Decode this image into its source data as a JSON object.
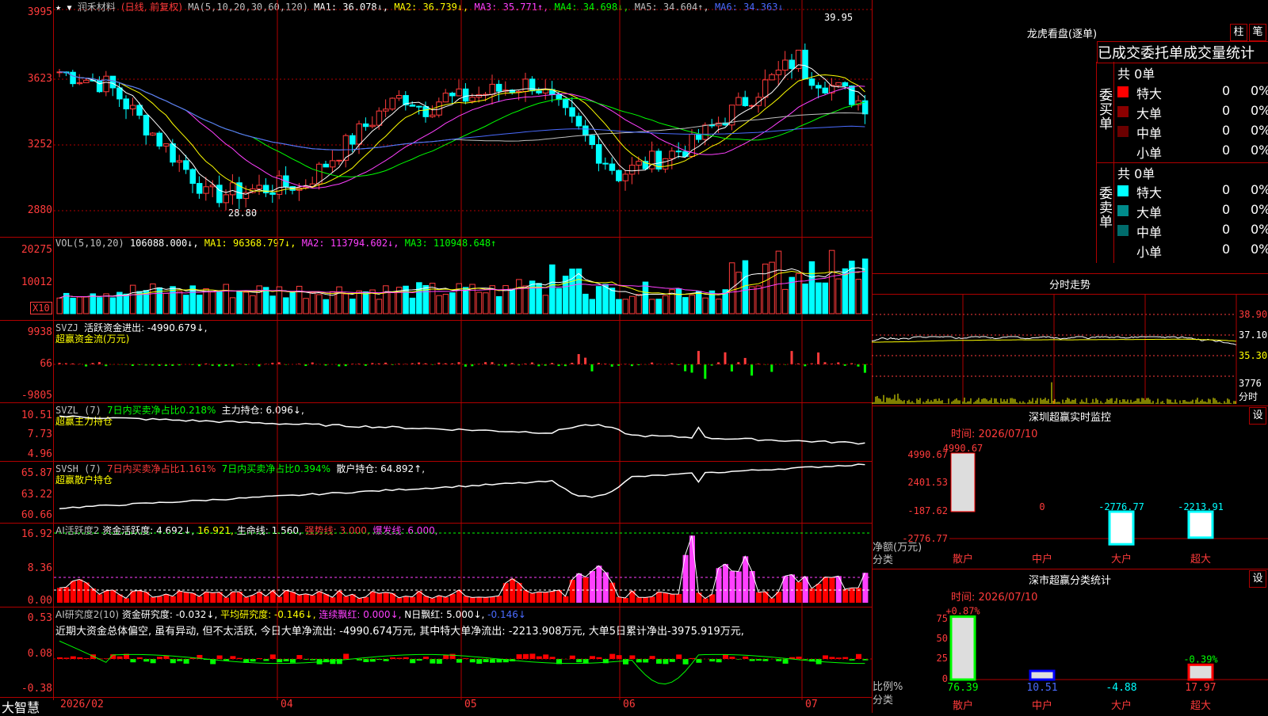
{
  "stock": {
    "name": "润禾材料",
    "mode": "(日线, 前复权)",
    "star": "★",
    "ma_header": {
      "label": "MA(5,10,20,30,60,120)",
      "ma1": "MA1: 36.078↓,",
      "ma2": "MA2: 36.739↓,",
      "ma3": "MA3: 35.771↑,",
      "ma4": "MA4: 34.698↓,",
      "ma5": "MA5: 34.604↑,",
      "ma6": "MA6: 34.363↓"
    },
    "price_axis": [
      "3995",
      "3623",
      "3252",
      "2880"
    ],
    "high_label": "39.95",
    "low_label": "28.80"
  },
  "volume": {
    "header": {
      "label": "VOL(5,10,20)",
      "value": "106088.000↓,",
      "ma1": "MA1: 96368.797↓,",
      "ma2": "MA2: 113794.602↓,",
      "ma3": "MA3: 110948.648↑"
    },
    "axis": [
      "20275",
      "10012"
    ],
    "unit": "X10"
  },
  "svzj": {
    "header": {
      "label": "SVZJ",
      "value": "活跃资金进出: -4990.679↓,",
      "subtitle": "超赢资金流(万元)"
    },
    "axis": [
      "9938",
      "66",
      "-9805"
    ]
  },
  "svzl": {
    "header": {
      "label": "SVZL (7)",
      "ratio": "7日内买卖净占比0.218%",
      "hold": "主力持仓: 6.096↓,",
      "subtitle": "超赢主力持仓"
    },
    "axis": [
      "10.51",
      "7.73",
      "4.96"
    ]
  },
  "svsh": {
    "header": {
      "label": "SVSH (7)",
      "ratio1": "7日内买卖净占比1.161%",
      "ratio2": "7日内买卖净占比0.394%",
      "hold": "散户持仓: 64.892↑,",
      "subtitle": "超赢散户持仓"
    },
    "axis": [
      "65.87",
      "63.22",
      "60.66"
    ]
  },
  "ai_active": {
    "header": {
      "label": "AI活跃度2",
      "a": "资金活跃度: 4.692↓,",
      "b": "16.921,",
      "c": "生命线: 1.560,",
      "d": "强势线: 3.000,",
      "e": "爆发线: 6.000,"
    },
    "axis": [
      "16.92",
      "8.36",
      "0.00"
    ]
  },
  "ai_research": {
    "header": {
      "label": "AI研究度2(10)",
      "a": "资金研究度: -0.032↓,",
      "b": "平均研究度: -0.146↓,",
      "c": "连续飘红: 0.000↓,",
      "d": "N日飘红: 5.000↓,",
      "e": "-0.146↓"
    },
    "comment": "近期大资金总体偏空, 虽有异动, 但不太活跃, 今日大单净流出: -4990.674万元, 其中特大单净流出: -2213.908万元, 大单5日累计净出-3975.919万元,",
    "axis": [
      "0.53",
      "0.08",
      "-0.38"
    ]
  },
  "date_axis": {
    "brand": "大智慧",
    "labels": [
      "2026/02",
      "04",
      "05",
      "06",
      "07"
    ]
  },
  "dragon_tiger": {
    "title": "龙虎看盘(逐单)",
    "btn_bar": "柱",
    "btn_pen": "笔",
    "tabs": [
      "已成交",
      "委托单",
      "成交量统计"
    ],
    "buy_side": {
      "label": "委买单",
      "total": "共 0单",
      "rows": [
        {
          "name": "特大",
          "count": "0",
          "pct": "0%",
          "color": "#ff0000"
        },
        {
          "name": "大单",
          "count": "0",
          "pct": "0%",
          "color": "#8b0000"
        },
        {
          "name": "中单",
          "count": "0",
          "pct": "0%",
          "color": "#6b0000"
        },
        {
          "name": "小单",
          "count": "0",
          "pct": "0%",
          "color": "#000000"
        }
      ]
    },
    "sell_side": {
      "label": "委卖单",
      "total": "共 0单",
      "rows": [
        {
          "name": "特大",
          "count": "0",
          "pct": "0%",
          "color": "#00ffff"
        },
        {
          "name": "大单",
          "count": "0",
          "pct": "0%",
          "color": "#008b8b"
        },
        {
          "name": "中单",
          "count": "0",
          "pct": "0%",
          "color": "#006b6b"
        },
        {
          "name": "小单",
          "count": "0",
          "pct": "0%",
          "color": "#000000"
        }
      ]
    }
  },
  "intraday": {
    "title": "分时走势",
    "axis": [
      "38.90",
      "37.10",
      "35.30",
      "3776"
    ],
    "unit": "分时"
  },
  "sz_monitor": {
    "title": "深圳超赢实时监控",
    "btn": "设",
    "time": "时间: 2026/07/10",
    "axis": [
      "4990.67",
      "2401.53",
      "-187.62",
      "-2776.77"
    ],
    "axis_title": "净额(万元)",
    "axis_sub": "分类",
    "chart_data": {
      "type": "bar",
      "categories": [
        "散户",
        "中户",
        "大户",
        "超大"
      ],
      "values": [
        4990.67,
        0,
        -2776.77,
        -2213.91
      ],
      "value_labels": [
        "4990.67",
        "0",
        "-2776.77",
        "-2213.91"
      ]
    }
  },
  "sz_class": {
    "title": "深市超赢分类统计",
    "btn": "设",
    "time": "时间: 2026/07/10",
    "axis": [
      "75",
      "50",
      "25",
      "0"
    ],
    "axis_title": "比例%",
    "axis_sub": "分类",
    "chart_data": {
      "type": "bar",
      "categories": [
        "散户",
        "中户",
        "大户",
        "超大"
      ],
      "values": [
        76.39,
        10.51,
        -4.88,
        17.97
      ],
      "change_labels": [
        "+0.87%",
        "",
        "",
        "-0.39%"
      ],
      "value_labels": [
        "76.39",
        "10.51",
        "-4.88",
        "17.97"
      ]
    }
  }
}
